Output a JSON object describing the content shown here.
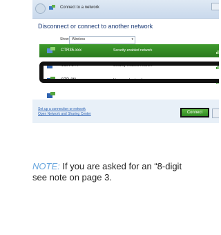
{
  "dialog": {
    "title": "Connect to a network",
    "heading": "Disconnect or connect to another network",
    "show_label": "Show",
    "show_value": "Wireless",
    "networks": [
      {
        "name": "CTR35-xxx",
        "status": "Security-enabled network",
        "selected": true
      },
      {
        "name": "MBR-344",
        "status": "Security-enabled network",
        "selected": false
      },
      {
        "name": "CTR-3f1",
        "status": "Unsecured network",
        "selected": false
      }
    ],
    "links": [
      "Set up a connection or network",
      "Open Network and Sharing Center"
    ],
    "connect_label": "Connect"
  },
  "colors": {
    "selection": "#2f8a22",
    "link": "#2c62b4",
    "heading": "#1e3d78",
    "note_prefix": "#6aa7de"
  },
  "note": {
    "prefix": "NOTE:",
    "line1": "If you are asked for an “8-digit",
    "line2": "see note on page 3."
  }
}
